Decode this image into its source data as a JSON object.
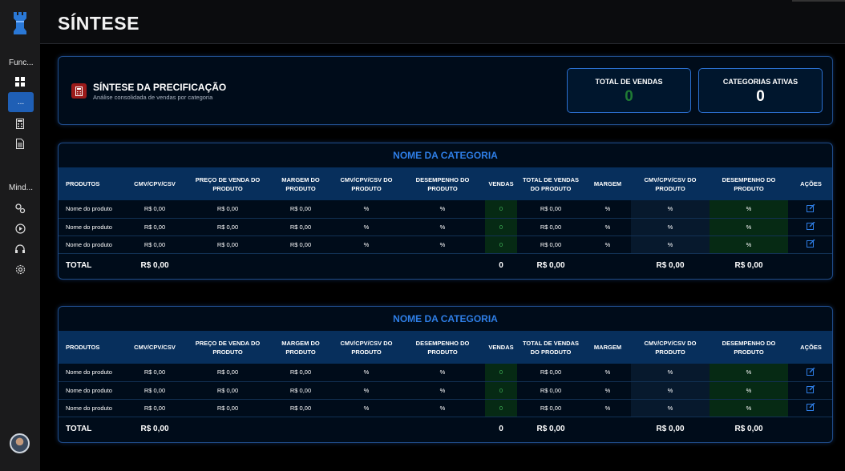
{
  "sidebar": {
    "section1_label": "Func...",
    "active_item_label": "...",
    "section2_label": "Mind..."
  },
  "header": {
    "title": "SÍNTESE"
  },
  "summary": {
    "title": "SÍNTESE DA PRECIFICAÇÃO",
    "subtitle": "Análise consolidada de vendas por categoria",
    "total_vendas_label": "TOTAL DE VENDAS",
    "total_vendas_value": "0",
    "categorias_label": "CATEGORIAS ATIVAS",
    "categorias_value": "0"
  },
  "colors": {
    "accent": "#2e7ee6",
    "green": "#3fb356",
    "header_bg": "#072f5c",
    "icon_red": "#9b1a1a"
  },
  "columns": [
    "PRODUTOS",
    "CMV/CPV/CSV",
    "PREÇO DE VENDA DO PRODUTO",
    "MARGEM DO PRODUTO",
    "CMV/CPV/CSV DO PRODUTO",
    "DESEMPENHO DO PRODUTO",
    "VENDAS",
    "TOTAL DE VENDAS DO PRODUTO",
    "MARGEM",
    "CMV/CPV/CSV DO PRODUTO",
    "DESEMPENHO DO PRODUTO",
    "AÇÕES"
  ],
  "categories": [
    {
      "name": "NOME DA CATEGORIA",
      "rows": [
        [
          "Nome do produto",
          "R$ 0,00",
          "R$ 0,00",
          "R$ 0,00",
          "%",
          "%",
          "0",
          "R$ 0,00",
          "%",
          "%",
          "%"
        ],
        [
          "Nome do produto",
          "R$ 0,00",
          "R$ 0,00",
          "R$ 0,00",
          "%",
          "%",
          "0",
          "R$ 0,00",
          "%",
          "%",
          "%"
        ],
        [
          "Nome do produto",
          "R$ 0,00",
          "R$ 0,00",
          "R$ 0,00",
          "%",
          "%",
          "0",
          "R$ 0,00",
          "%",
          "%",
          "%"
        ]
      ],
      "total": {
        "label": "TOTAL",
        "cmv": "R$ 0,00",
        "vendas": "0",
        "total_vendas": "R$ 0,00",
        "cmv_produto": "R$ 0,00",
        "desempenho": "R$ 0,00"
      }
    },
    {
      "name": "NOME DA CATEGORIA",
      "rows": [
        [
          "Nome do produto",
          "R$ 0,00",
          "R$ 0,00",
          "R$ 0,00",
          "%",
          "%",
          "0",
          "R$ 0,00",
          "%",
          "%",
          "%"
        ],
        [
          "Nome do produto",
          "R$ 0,00",
          "R$ 0,00",
          "R$ 0,00",
          "%",
          "%",
          "0",
          "R$ 0,00",
          "%",
          "%",
          "%"
        ],
        [
          "Nome do produto",
          "R$ 0,00",
          "R$ 0,00",
          "R$ 0,00",
          "%",
          "%",
          "0",
          "R$ 0,00",
          "%",
          "%",
          "%"
        ]
      ],
      "total": {
        "label": "TOTAL",
        "cmv": "R$ 0,00",
        "vendas": "0",
        "total_vendas": "R$ 0,00",
        "cmv_produto": "R$ 0,00",
        "desempenho": "R$ 0,00"
      }
    }
  ]
}
